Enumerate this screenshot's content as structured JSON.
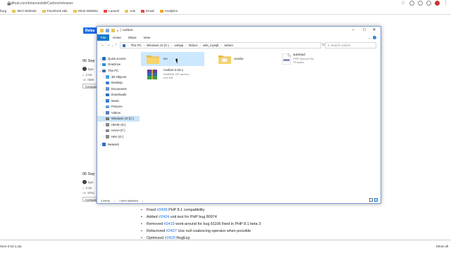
{
  "browser": {
    "url": "github.com/briannesbitt/Carbon/releases",
    "bookmarks": [
      "burg",
      "SEO Website",
      "Facebook ads",
      "Struk Website",
      "Laravel",
      "Ads",
      "Email",
      "Analytics"
    ]
  },
  "github": {
    "release_button": "Relea",
    "entries": [
      {
        "date": "06 Sep",
        "author": "kyle",
        "tag": "2.53.",
        "commit": "f469",
        "compare": "Compare"
      },
      {
        "date": "06 Sep",
        "author": "kyle",
        "tag": "2.52.",
        "commit": "8751",
        "compare": "Compare"
      }
    ],
    "changelog": [
      {
        "prefix": "Fixed ",
        "link": "#2439",
        "text": " PHP 8.1 compatibility"
      },
      {
        "prefix": "Added ",
        "link": "#2424",
        "text": " unit test for PHP bug 80974"
      },
      {
        "prefix": "Removed ",
        "link": "#2419",
        "text": " work-around for bug 81106 fixed in PHP 8.1 beta 3"
      },
      {
        "prefix": "Refactored ",
        "link": "#2427",
        "text": " Use null coalescing operator when possible"
      },
      {
        "prefix": "Optimized ",
        "link": "#2429",
        "text": " RegExp"
      }
    ]
  },
  "download_bar": {
    "file": "rbon-2.53.1.zip",
    "show_all": "Show all"
  },
  "explorer": {
    "title": "carbon",
    "ribbon_tabs": [
      "File",
      "Home",
      "Share",
      "View"
    ],
    "breadcrumb": [
      "This PC",
      "Windows 10 (C:)",
      "xampp",
      "htdocs",
      "web_mysqli",
      "carbon"
    ],
    "search_placeholder": "Search carbon",
    "sidebar": [
      {
        "label": "Quick access",
        "icon": "star-icon",
        "color": "#2d6fb8",
        "level": 0,
        "chev": ">"
      },
      {
        "label": "OneDrive",
        "icon": "cloud-icon",
        "color": "#2d8fd5",
        "level": 0,
        "chev": ">"
      },
      {
        "label": "This PC",
        "icon": "computer-icon",
        "color": "#4a6fa5",
        "level": 0,
        "chev": "v"
      },
      {
        "label": "3D Objects",
        "icon": "cube-icon",
        "color": "#4aa3df",
        "level": 1,
        "chev": ">"
      },
      {
        "label": "Desktop",
        "icon": "desktop-icon",
        "color": "#3a7bd5",
        "level": 1,
        "chev": ">"
      },
      {
        "label": "Documents",
        "icon": "documents-icon",
        "color": "#6a8fbf",
        "level": 1,
        "chev": ">"
      },
      {
        "label": "Downloads",
        "icon": "download-icon",
        "color": "#2d6fb8",
        "level": 1,
        "chev": ">"
      },
      {
        "label": "Music",
        "icon": "music-icon",
        "color": "#3a7bd5",
        "level": 1,
        "chev": ">"
      },
      {
        "label": "Pictures",
        "icon": "pictures-icon",
        "color": "#6a9fd5",
        "level": 1,
        "chev": ">"
      },
      {
        "label": "Videos",
        "icon": "videos-icon",
        "color": "#5a7fb5",
        "level": 1,
        "chev": ">"
      },
      {
        "label": "Windows 10 (C:)",
        "icon": "drive-icon",
        "color": "#777777",
        "level": 1,
        "chev": ">",
        "selected": true
      },
      {
        "label": "HEHE (D:)",
        "icon": "drive-icon",
        "color": "#888888",
        "level": 1,
        "chev": ">"
      },
      {
        "label": "HAHA (F:)",
        "icon": "drive-icon",
        "color": "#888888",
        "level": 1,
        "chev": ">"
      },
      {
        "label": "HIHI (G:)",
        "icon": "drive-icon",
        "color": "#888888",
        "level": 1,
        "chev": ">"
      },
      {
        "label": "Network",
        "icon": "network-icon",
        "color": "#2d6fb8",
        "level": 0,
        "chev": ">"
      }
    ],
    "items": [
      {
        "name": "src",
        "type": "folder"
      },
      {
        "name": "vendor",
        "type": "folder"
      },
      {
        "name": "autoload",
        "type": "php",
        "sub1": "PHP Source File",
        "sub2": "75 bytes"
      },
      {
        "name": "Carbon-2.53.1",
        "type": "zip",
        "sub1": "WinRAR ZIP archive",
        "sub2": "615 KB"
      }
    ],
    "status": {
      "count": "4 items",
      "selected": "1 item selected"
    }
  }
}
